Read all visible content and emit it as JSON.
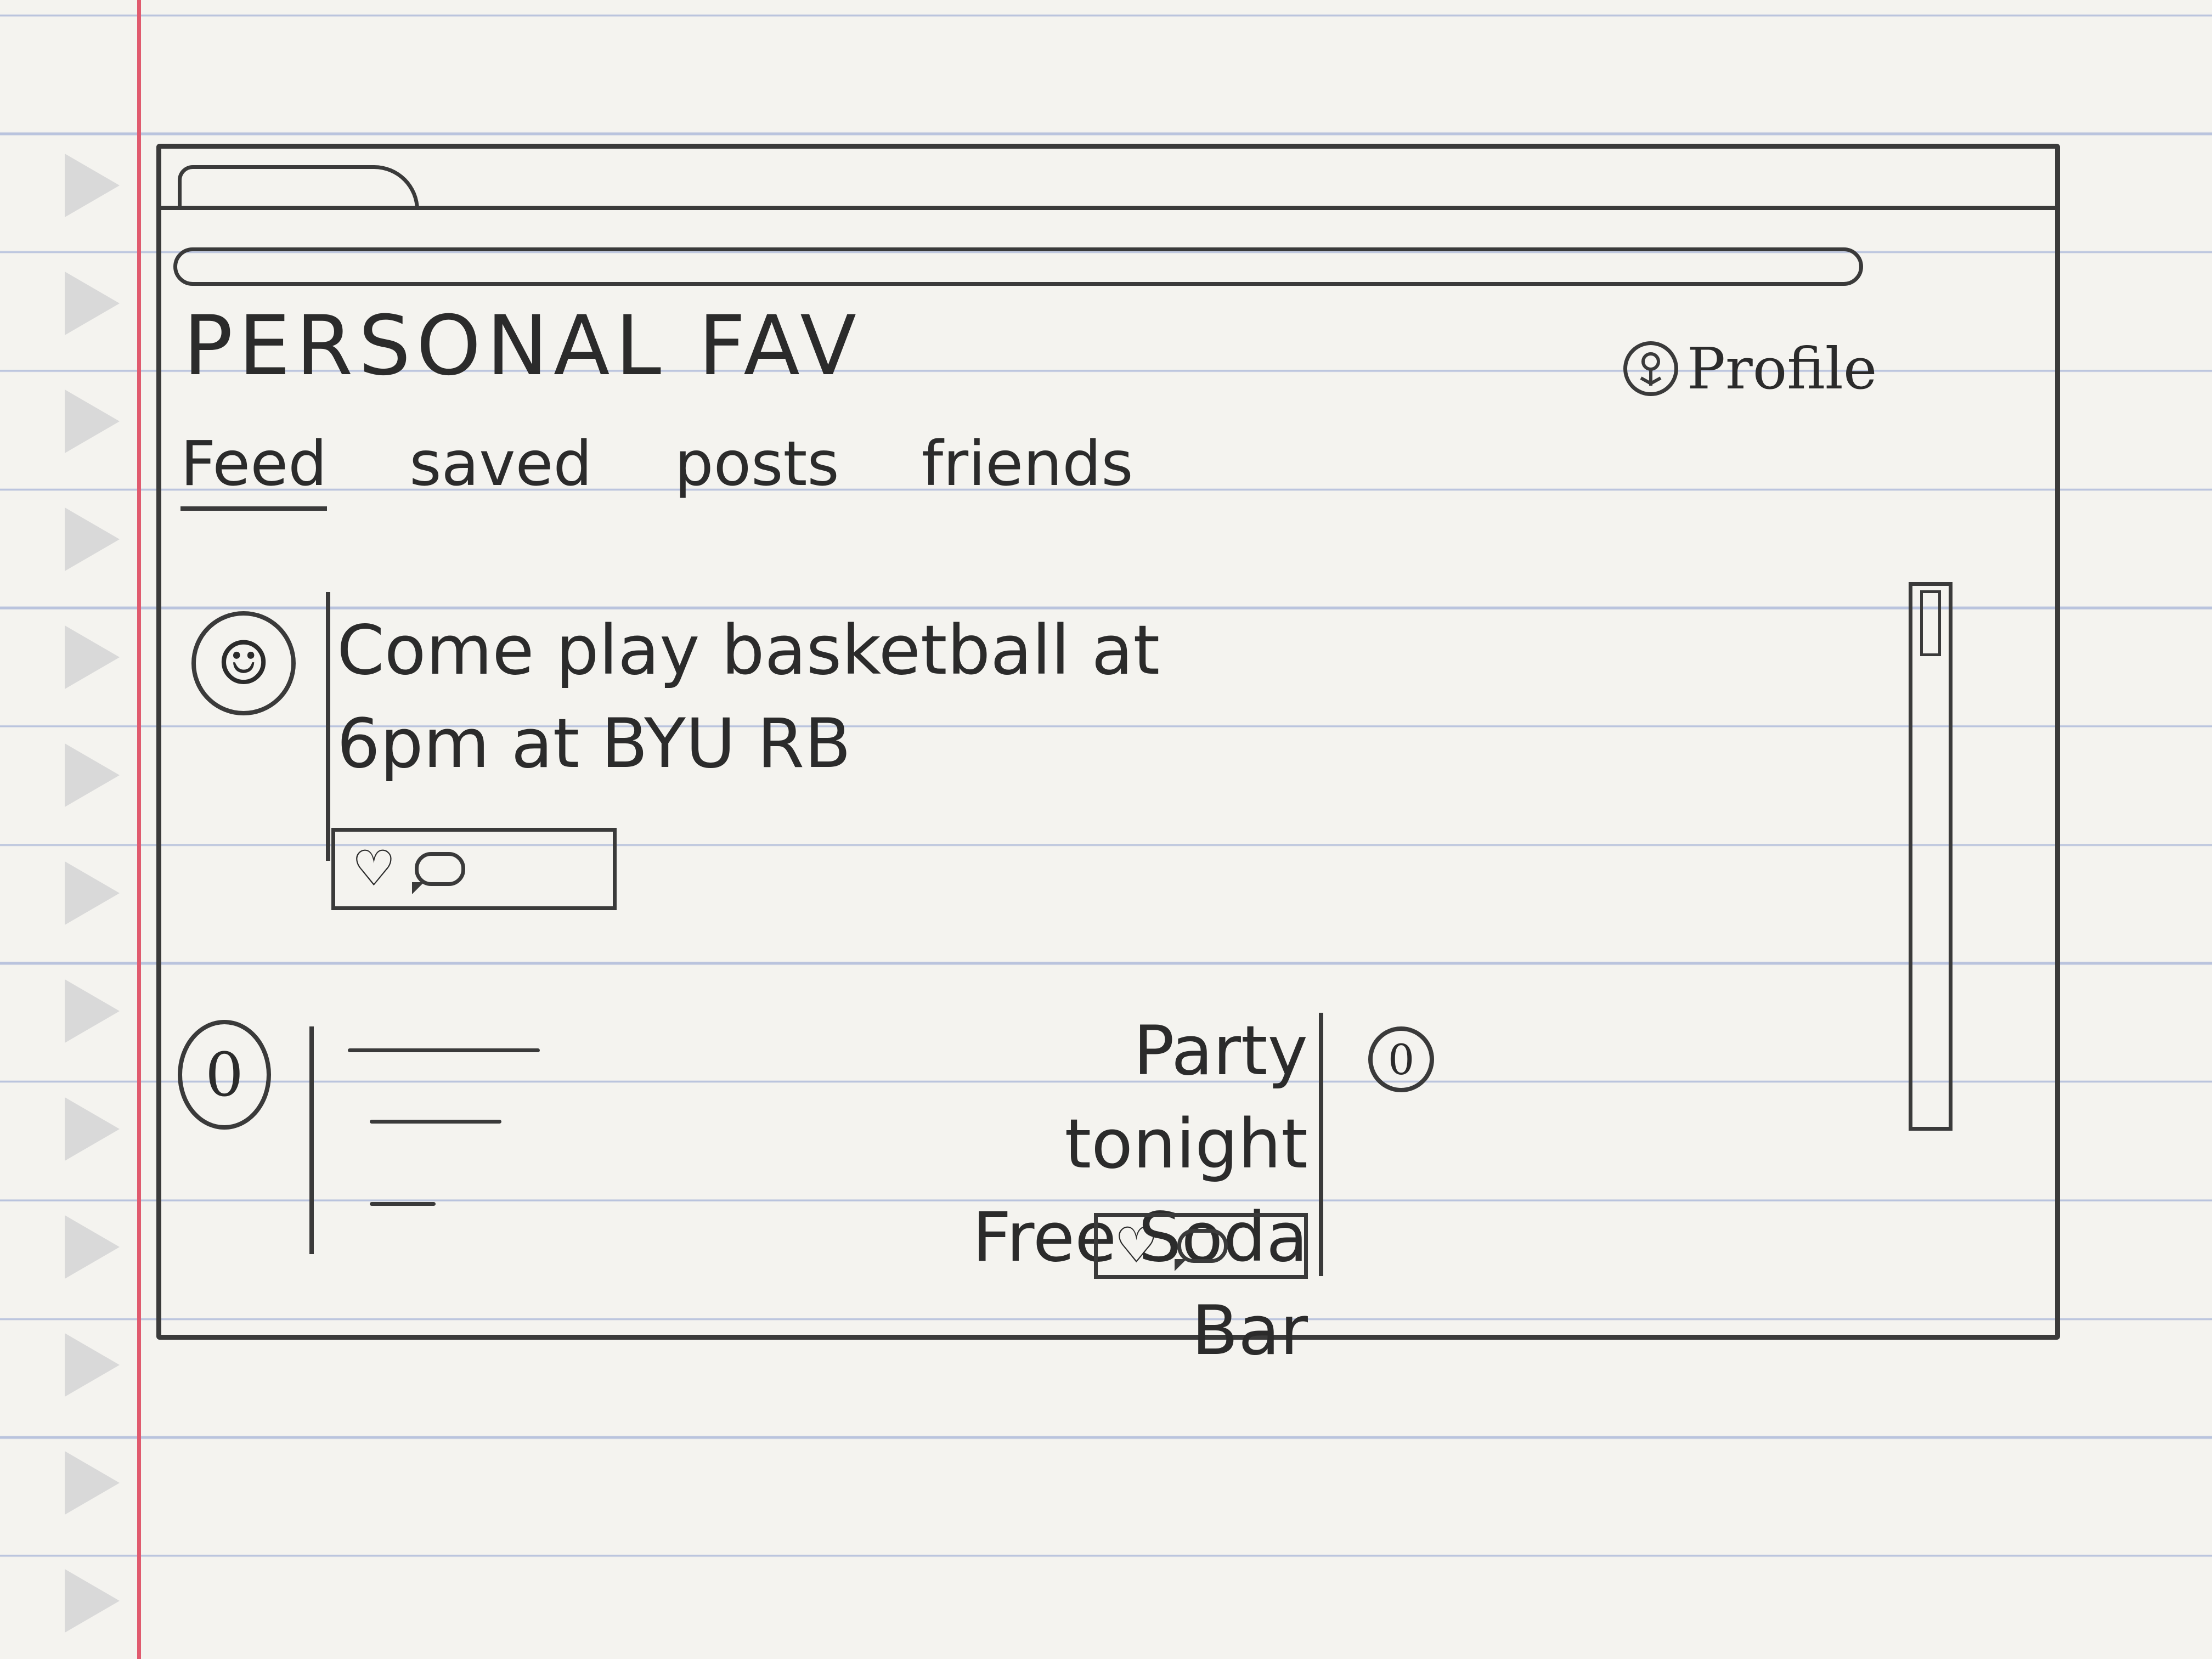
{
  "header": {
    "app_title": "PERSONAL FAV",
    "profile_label": "Profile"
  },
  "nav": {
    "tabs": [
      {
        "label": "Feed",
        "active": true
      },
      {
        "label": "saved",
        "active": false
      },
      {
        "label": "posts",
        "active": false
      },
      {
        "label": "friends",
        "active": false
      }
    ]
  },
  "feed": {
    "posts": [
      {
        "text": "Come play basketball at\n6pm at BYU RB"
      },
      {
        "text": ""
      },
      {
        "text": "Party tonight\nFree Soda Bar"
      }
    ]
  },
  "icons": {
    "profile": "user-icon",
    "like": "heart-icon",
    "comment": "comment-icon"
  }
}
